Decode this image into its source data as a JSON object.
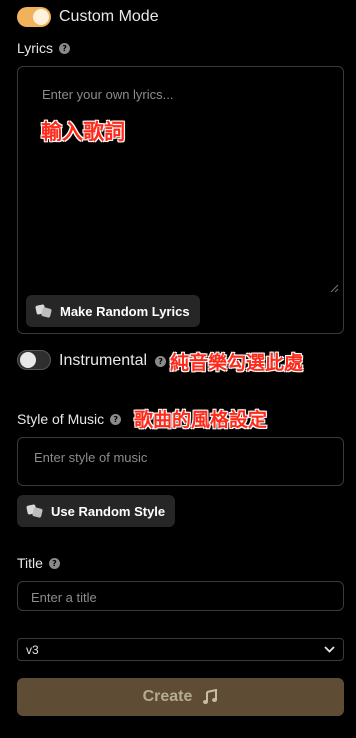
{
  "custom_mode": {
    "label": "Custom Mode",
    "enabled": true
  },
  "lyrics": {
    "label": "Lyrics",
    "placeholder": "Enter your own lyrics...",
    "random_button": "Make Random Lyrics",
    "annotation": "輸入歌詞"
  },
  "instrumental": {
    "label": "Instrumental",
    "enabled": false,
    "annotation": "純音樂勾選此處"
  },
  "style": {
    "label": "Style of Music",
    "placeholder": "Enter style of music",
    "random_button": "Use Random Style",
    "annotation": "歌曲的風格設定"
  },
  "title": {
    "label": "Title",
    "placeholder": "Enter a title"
  },
  "version": {
    "selected": "v3"
  },
  "create": {
    "label": "Create"
  },
  "colors": {
    "accent": "#f2b25c",
    "create_bg": "#5e4d34",
    "annotation": "#ff2a1a"
  }
}
